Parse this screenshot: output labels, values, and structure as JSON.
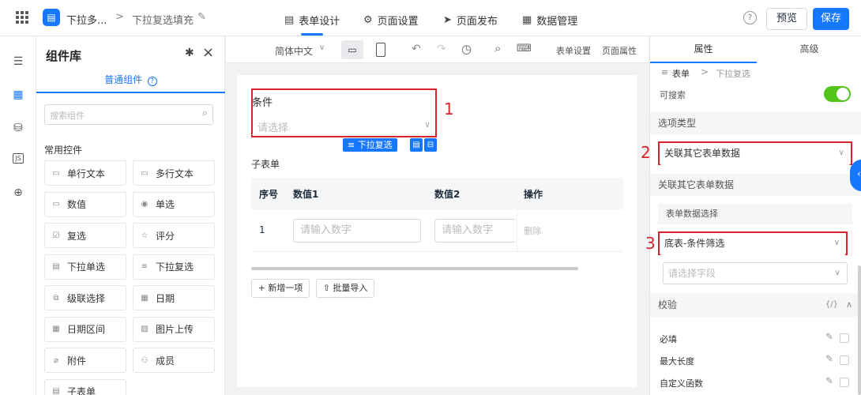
{
  "header": {
    "app_icon": "▤",
    "app_name": "下拉多...",
    "breadcrumb_sep": ">",
    "form_name": "下拉复选填充",
    "tabs": [
      {
        "icon": "▤",
        "label": "表单设计"
      },
      {
        "icon": "⚙",
        "label": "页面设置"
      },
      {
        "icon": "➤",
        "label": "页面发布"
      },
      {
        "icon": "▦",
        "label": "数据管理"
      }
    ],
    "help_icon": "?",
    "preview_label": "预览",
    "save_label": "保存"
  },
  "library": {
    "title": "组件库",
    "pin_icon": "✱",
    "close_icon": "×",
    "tab_label": "普通组件",
    "tab_info_icon": "?",
    "search_placeholder": "搜索组件",
    "section_label": "常用控件",
    "items": [
      {
        "icon": "▭",
        "label": "单行文本"
      },
      {
        "icon": "▭",
        "label": "多行文本"
      },
      {
        "icon": "▭",
        "label": "数值"
      },
      {
        "icon": "◉",
        "label": "单选"
      },
      {
        "icon": "☑",
        "label": "复选"
      },
      {
        "icon": "☆",
        "label": "评分"
      },
      {
        "icon": "▤",
        "label": "下拉单选"
      },
      {
        "icon": "≡",
        "label": "下拉复选"
      },
      {
        "icon": "⧉",
        "label": "级联选择"
      },
      {
        "icon": "▦",
        "label": "日期"
      },
      {
        "icon": "▦",
        "label": "日期区间"
      },
      {
        "icon": "▨",
        "label": "图片上传"
      },
      {
        "icon": "⌀",
        "label": "附件"
      },
      {
        "icon": "⚇",
        "label": "成员"
      },
      {
        "icon": "▤",
        "label": "子表单"
      }
    ]
  },
  "toolbar": {
    "language": "简体中文",
    "form_settings": "表单设置",
    "page_props": "页面属性"
  },
  "canvas": {
    "field_label": "条件",
    "field_placeholder": "请选择",
    "annotation_1": "1",
    "selected_tag": "下拉复选",
    "subform_label": "子表单",
    "table_headers": [
      "序号",
      "数值1",
      "数值2",
      "操作"
    ],
    "row_index": "1",
    "row_input1": "请输入数字",
    "row_input2": "请输入数字",
    "row_action": "删除",
    "add_btn": "+ 新增一项",
    "import_btn": "批量导入"
  },
  "props": {
    "tab_props": "属性",
    "tab_advanced": "高级",
    "crumb_1": "表单",
    "crumb_sep": ">",
    "crumb_2": "下拉复选",
    "searchable_label": "可搜索",
    "searchable_on": true,
    "option_type_label": "选项类型",
    "option_type_value": "关联其它表单数据",
    "annotation_2": "2",
    "linked_label": "关联其它表单数据",
    "form_select_label": "表单数据选择",
    "form_select_value": "底表-条件筛选",
    "annotation_3": "3",
    "field_placeholder": "请选择字段",
    "validation_label": "校验",
    "validation_icon": "{/}",
    "rules": [
      "必填",
      "最大长度",
      "自定义函数"
    ]
  },
  "colors": {
    "accent": "#1677ff",
    "annotation": "#d9232d",
    "toggle": "#52c41a"
  }
}
